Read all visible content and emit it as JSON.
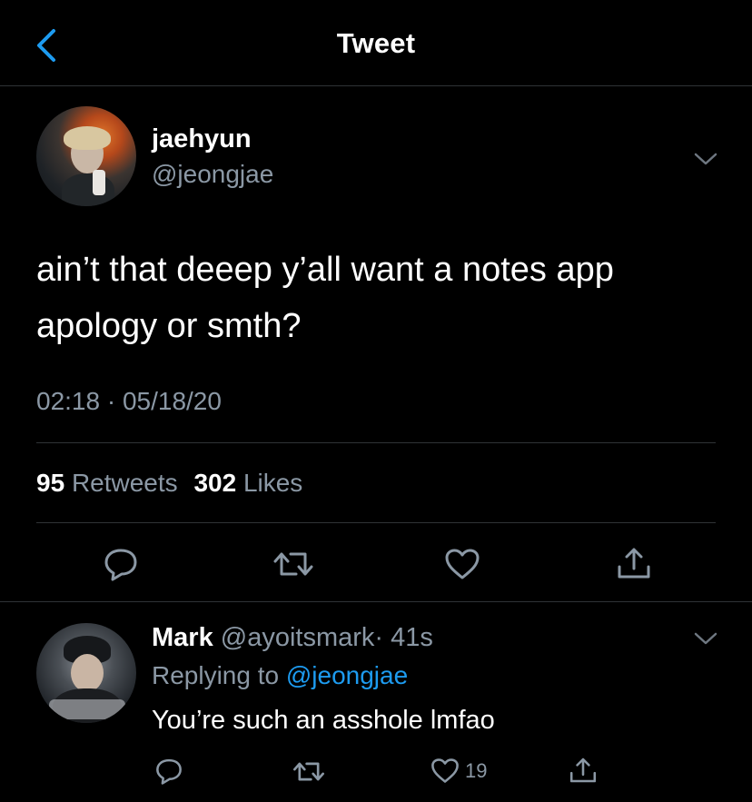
{
  "header": {
    "title": "Tweet",
    "back_icon": "chevron-left-icon"
  },
  "tweet": {
    "author": {
      "name": "jaehyun",
      "handle": "@jeongjae"
    },
    "text": "ain’t that deeep y’all want a notes app apology or smth?",
    "timestamp": "02:18 · 05/18/20",
    "stats": {
      "retweets_count": "95",
      "retweets_label": "Retweets",
      "likes_count": "302",
      "likes_label": "Likes"
    },
    "actions": [
      "reply-icon",
      "retweet-icon",
      "like-icon",
      "share-icon"
    ]
  },
  "reply": {
    "author": {
      "name": "Mark",
      "handle": "@ayoitsmark",
      "time": "· 41s"
    },
    "replying_prefix": "Replying to",
    "replying_mention": "@jeongjae",
    "text": "You’re such an asshole lmfao",
    "like_count": "19",
    "actions": [
      "reply-icon",
      "retweet-icon",
      "like-icon",
      "share-icon"
    ]
  },
  "colors": {
    "background": "#000000",
    "text": "#ffffff",
    "secondary": "#8b98a5",
    "accent": "#1d9bf0",
    "divider": "#2f3336"
  }
}
